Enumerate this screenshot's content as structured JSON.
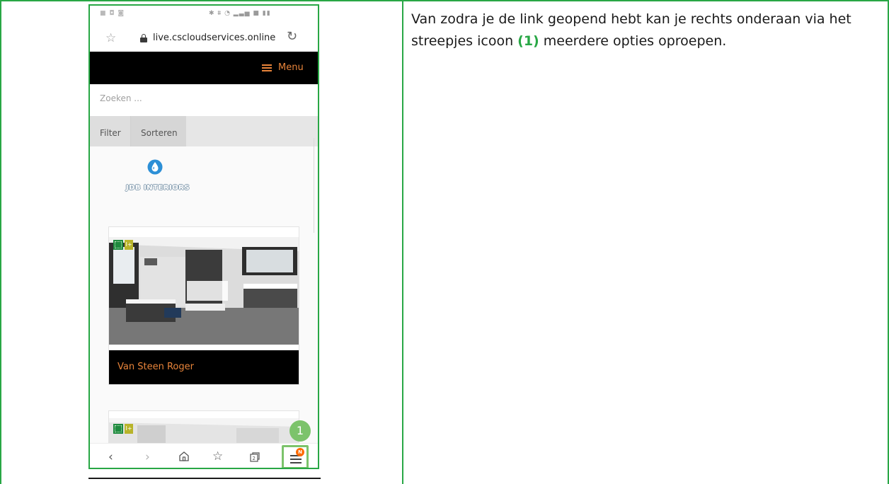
{
  "instruction": {
    "text_before": "Van zodra je de link geopend hebt kan je rechts onderaan via het streepjes icoon ",
    "step_ref": "(1)",
    "text_after": " meerdere opties oproepen."
  },
  "browser": {
    "url": "live.cscloudservices.online"
  },
  "site": {
    "menu_label": "Menu",
    "search_placeholder": "Zoeken ...",
    "filter_label": "Filter",
    "sort_label": "Sorteren",
    "brand_name": "JDB INTERIORS",
    "card_title": "Van Steen Roger"
  },
  "bottom_nav": {
    "notification_badge": "N"
  },
  "step_marker": "1",
  "colors": {
    "accent_green": "#28a745",
    "menu_orange": "#e8843a",
    "highlight_green": "#7cc36b"
  },
  "icons": [
    "star-icon",
    "lock-icon",
    "reload-icon",
    "hamburger-icon",
    "water-drop-icon",
    "back-icon",
    "forward-icon",
    "home-icon",
    "bookmarks-icon",
    "tabs-icon",
    "menu-icon"
  ]
}
